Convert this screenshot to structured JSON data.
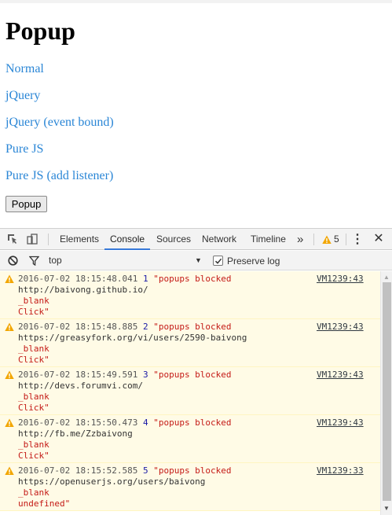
{
  "page": {
    "title": "Popup",
    "links": [
      "Normal",
      "jQuery",
      "jQuery (event bound)",
      "Pure JS",
      "Pure JS (add listener)"
    ],
    "button_label": "Popup"
  },
  "devtools": {
    "tabs": [
      "Elements",
      "Console",
      "Sources",
      "Network",
      "Timeline"
    ],
    "active_tab": "Console",
    "more_tabs": "»",
    "warning_count": "5",
    "menu_icon": "⋮",
    "close_icon": "✕",
    "context": "top",
    "preserve_log_label": "Preserve log",
    "preserve_log_checked": true
  },
  "console": {
    "messages": [
      {
        "timestamp": "2016-07-02 18:15:48.041",
        "count": "1",
        "text": "\"popups blocked",
        "url": "http://baivong.github.io/",
        "target": "_blank",
        "event": "Click\"",
        "source": "VM1239:43"
      },
      {
        "timestamp": "2016-07-02 18:15:48.885",
        "count": "2",
        "text": "\"popups blocked",
        "url": "https://greasyfork.org/vi/users/2590-baivong",
        "target": "_blank",
        "event": "Click\"",
        "source": "VM1239:43"
      },
      {
        "timestamp": "2016-07-02 18:15:49.591",
        "count": "3",
        "text": "\"popups blocked",
        "url": "http://devs.forumvi.com/",
        "target": "_blank",
        "event": "Click\"",
        "source": "VM1239:43"
      },
      {
        "timestamp": "2016-07-02 18:15:50.473",
        "count": "4",
        "text": "\"popups blocked",
        "url": "http://fb.me/Zzbaivong",
        "target": "_blank",
        "event": "Click\"",
        "source": "VM1239:43"
      },
      {
        "timestamp": "2016-07-02 18:15:52.585",
        "count": "5",
        "text": "\"popups blocked",
        "url": "https://openuserjs.org/users/baivong",
        "target": "_blank",
        "event": "undefined\"",
        "source": "VM1239:33"
      }
    ]
  },
  "colors": {
    "link": "#2a86d6",
    "warning": "#f2a600",
    "active_tab": "#3879d9",
    "warning_bg": "#fffbe6"
  }
}
